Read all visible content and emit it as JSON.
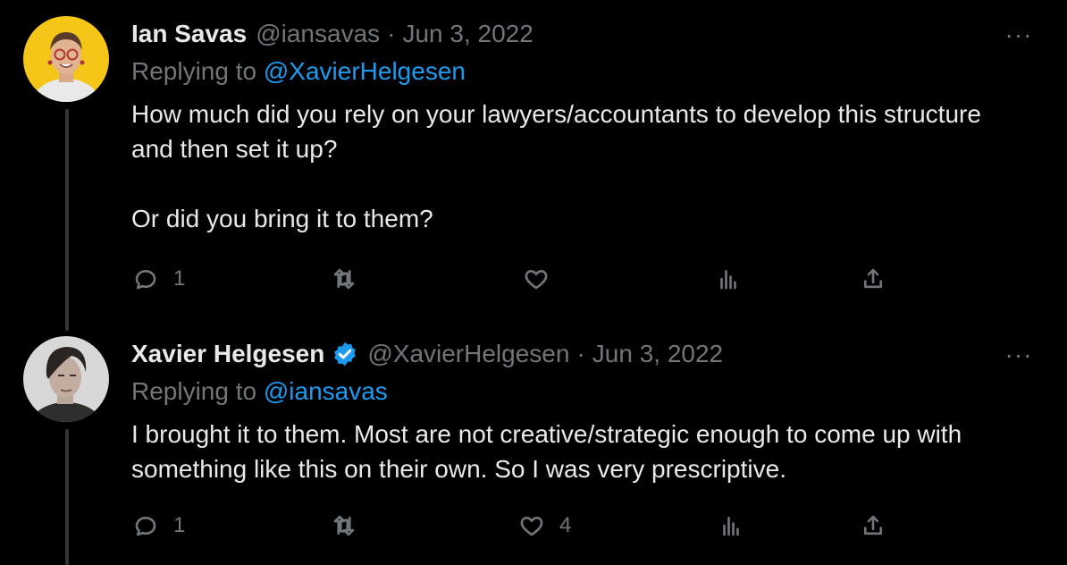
{
  "tweets": [
    {
      "display_name": "Ian Savas",
      "handle": "@iansavas",
      "separator": "·",
      "date": "Jun 3, 2022",
      "replying_prefix": "Replying to ",
      "replying_to": "@XavierHelgesen",
      "paragraphs": [
        "How much did you rely on your lawyers/accountants to develop this structure and then set it up?",
        "Or did you bring it to them?"
      ],
      "reply_count": "1",
      "repost_count": "",
      "like_count": "",
      "verified": false,
      "avatar_color": "#f5c518"
    },
    {
      "display_name": "Xavier Helgesen",
      "handle": "@XavierHelgesen",
      "separator": "·",
      "date": "Jun 3, 2022",
      "replying_prefix": "Replying to ",
      "replying_to": "@iansavas",
      "paragraphs": [
        "I brought it to them. Most are not creative/strategic enough to come up with something like this on their own. So I was very prescriptive."
      ],
      "reply_count": "1",
      "repost_count": "",
      "like_count": "4",
      "verified": true,
      "avatar_color": "#8a8f94"
    }
  ],
  "more_label": "···",
  "icons": [
    "reply-icon",
    "repost-icon",
    "like-icon",
    "views-icon",
    "share-icon",
    "more-icon",
    "verified-badge-icon"
  ],
  "colors": {
    "background": "#000000",
    "text": "#e7e9ea",
    "secondary": "#71767b",
    "accent": "#1d9bf0",
    "thread_line": "#333639"
  }
}
